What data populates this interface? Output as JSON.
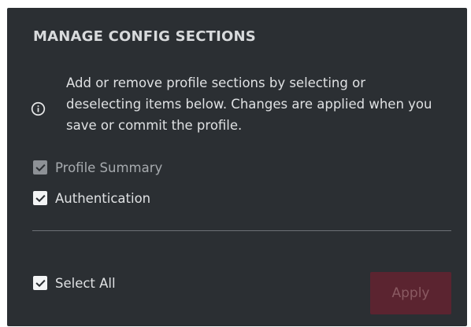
{
  "panel": {
    "title": "MANAGE CONFIG SECTIONS",
    "info": {
      "icon": "info-icon",
      "text": "Add or remove profile sections by selecting or deselecting items below. Changes are applied when you save or commit the profile."
    },
    "sections": [
      {
        "label": "Profile Summary",
        "checked": true,
        "disabled": true
      },
      {
        "label": "Authentication",
        "checked": true,
        "disabled": false
      }
    ],
    "select_all": {
      "label": "Select All",
      "checked": true
    },
    "apply_button": {
      "label": "Apply",
      "disabled": true
    }
  },
  "colors": {
    "panel_bg": "#2b2f33",
    "text": "#dfe1e3",
    "apply_bg": "#5b2430",
    "apply_text": "#8a5a62"
  }
}
